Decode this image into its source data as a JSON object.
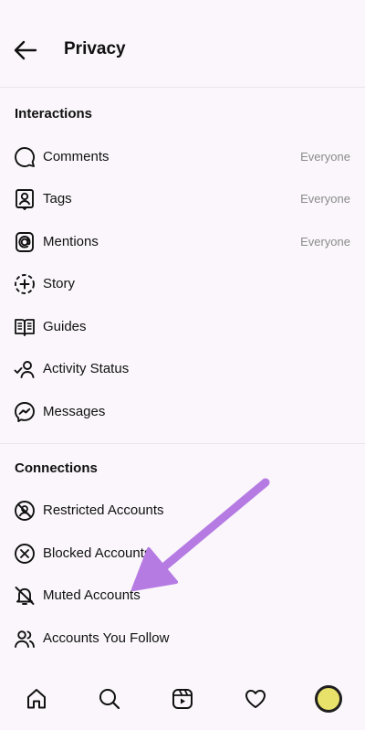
{
  "header": {
    "title": "Privacy"
  },
  "sections": {
    "interactions": {
      "title": "Interactions",
      "items": [
        {
          "label": "Comments",
          "value": "Everyone",
          "icon": "comment-icon"
        },
        {
          "label": "Tags",
          "value": "Everyone",
          "icon": "tag-person-icon"
        },
        {
          "label": "Mentions",
          "value": "Everyone",
          "icon": "at-sign-icon"
        },
        {
          "label": "Story",
          "icon": "story-add-icon"
        },
        {
          "label": "Guides",
          "icon": "guides-book-icon"
        },
        {
          "label": "Activity Status",
          "icon": "activity-status-icon"
        },
        {
          "label": "Messages",
          "icon": "messenger-icon"
        }
      ]
    },
    "connections": {
      "title": "Connections",
      "items": [
        {
          "label": "Restricted Accounts",
          "icon": "restricted-icon"
        },
        {
          "label": "Blocked Accounts",
          "icon": "blocked-icon"
        },
        {
          "label": "Muted Accounts",
          "icon": "muted-bell-icon"
        },
        {
          "label": "Accounts You Follow",
          "icon": "following-icon"
        }
      ]
    }
  },
  "bottom_nav": [
    "home-icon",
    "search-icon",
    "reels-icon",
    "activity-heart-icon",
    "profile-avatar"
  ],
  "colors": {
    "background": "#faf6fb",
    "secondary_text": "#8b8b8b",
    "annotation_arrow": "#b57be3"
  }
}
